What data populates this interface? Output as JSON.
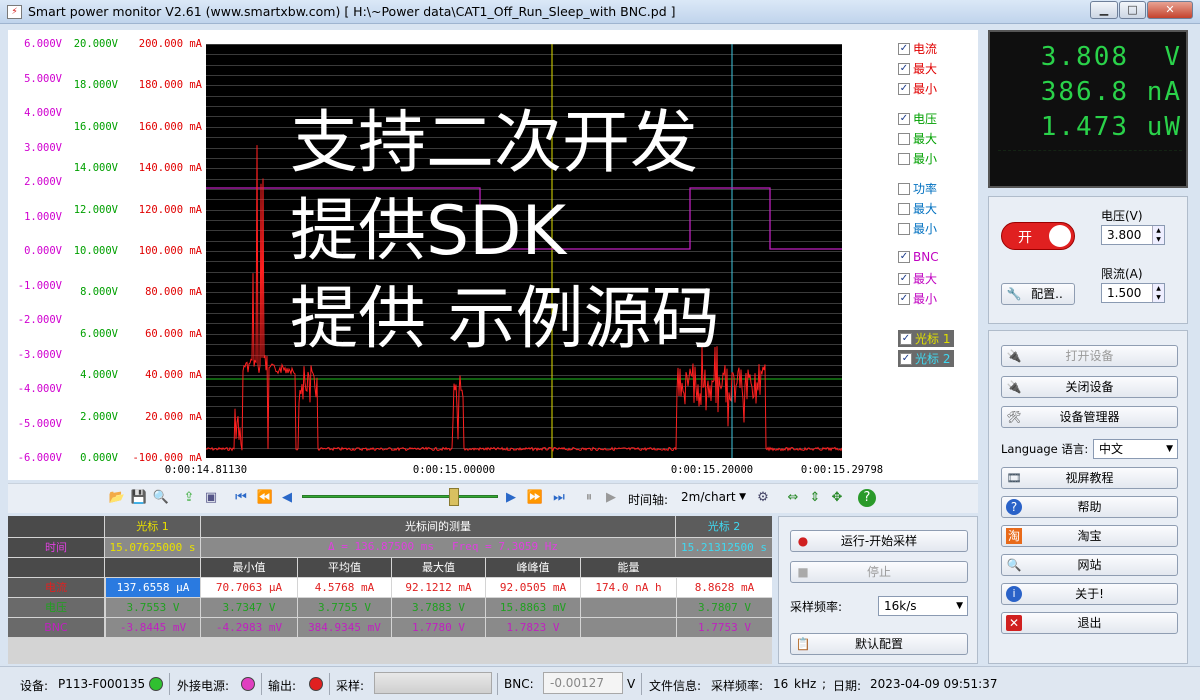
{
  "window": {
    "title": "Smart power monitor V2.61 (www.smartxbw.com) [ H:\\~Power data\\CAT1_Off_Run_Sleep_with BNC.pd ]",
    "min": "▁",
    "max": "□",
    "close": "✕"
  },
  "chart": {
    "overlay_lines": [
      "支持二次开发",
      "提供SDK",
      "提供 示例源码"
    ],
    "voltage_axis": [
      "6.000V",
      "5.000V",
      "4.000V",
      "3.000V",
      "2.000V",
      "1.000V",
      "0.000V",
      "-1.000V",
      "-2.000V",
      "-3.000V",
      "-4.000V",
      "-5.000V",
      "-6.000V"
    ],
    "bnc_axis": [
      "20.000V",
      "18.000V",
      "16.000V",
      "14.000V",
      "12.000V",
      "10.000V",
      "8.000V",
      "6.000V",
      "4.000V",
      "2.000V",
      "0.000V"
    ],
    "current_axis": [
      "200.000 mA",
      "180.000 mA",
      "160.000 mA",
      "140.000 mA",
      "120.000 mA",
      "100.000 mA",
      "80.000 mA",
      "60.000 mA",
      "40.000 mA",
      "20.000 mA",
      "-100.000 mA"
    ],
    "time_ticks": [
      "0:00:14.81130",
      "0:00:15.00000",
      "0:00:15.20000",
      "0:00:15.29798"
    ],
    "colors": {
      "voltage_axis": "#d000d0",
      "bnc_axis": "#00a000",
      "current_axis": "#e00000",
      "cursor1": "#e0e000",
      "cursor2": "#40c8e0"
    }
  },
  "chart_data": {
    "type": "line",
    "title": "",
    "xlabel": "",
    "ylabel": "",
    "x_range": [
      "0:00:14.81130",
      "0:00:15.29798"
    ],
    "series": [
      {
        "name": "电流",
        "color": "#ff2020"
      },
      {
        "name": "电压",
        "color": "#c020c0"
      },
      {
        "name": "BNC",
        "color": "#20c020"
      }
    ]
  },
  "legend": {
    "items": [
      {
        "label": "电流",
        "checked": true,
        "color": "#e00000"
      },
      {
        "label": "最大",
        "checked": true,
        "color": "#e00000"
      },
      {
        "label": "最小",
        "checked": true,
        "color": "#e00000"
      },
      {
        "label": "电压",
        "checked": true,
        "color": "#00a000"
      },
      {
        "label": "最大",
        "checked": false,
        "color": "#00a000"
      },
      {
        "label": "最小",
        "checked": false,
        "color": "#00a000"
      },
      {
        "label": "功率",
        "checked": false,
        "color": "#0070c0"
      },
      {
        "label": "最大",
        "checked": false,
        "color": "#0070c0"
      },
      {
        "label": "最小",
        "checked": false,
        "color": "#0070c0"
      },
      {
        "label": "BNC",
        "checked": true,
        "color": "#c000c0"
      },
      {
        "label": "最大",
        "checked": true,
        "color": "#c000c0"
      },
      {
        "label": "最小",
        "checked": true,
        "color": "#c000c0"
      },
      {
        "label": "光标 1",
        "checked": true,
        "color": "#e0e000",
        "bg": "#6a6a6a"
      },
      {
        "label": "光标 2",
        "checked": true,
        "color": "#40d8f0",
        "bg": "#6a6a6a"
      }
    ]
  },
  "toolbar": {
    "time_axis_label": "时间轴:",
    "time_axis_value": "2m/chart"
  },
  "measure": {
    "cursor1_header": "光标 1",
    "between_header": "光标间的测量",
    "cursor2_header": "光标 2",
    "time_label": "时间",
    "cursor1_time": "15.07625000 s",
    "delta_text": "Δ = 136.87500 ms",
    "freq_text": "Freq = 7.3059 Hz",
    "cursor2_time": "15.21312500 s",
    "columns": [
      "最小值",
      "平均值",
      "最大值",
      "峰峰值",
      "能量"
    ],
    "rows": [
      {
        "label": "电流",
        "c1": "137.6558 μA",
        "min": "70.7063 μA",
        "avg": "4.5768 mA",
        "max": "92.1212 mA",
        "pp": "92.0505 mA",
        "energy": "174.0 nA h",
        "c2": "8.8628 mA"
      },
      {
        "label": "电压",
        "c1": "3.7553 V",
        "min": "3.7347 V",
        "avg": "3.7755 V",
        "max": "3.7883 V",
        "pp": "15.8863 mV",
        "energy": "",
        "c2": "3.7807 V"
      },
      {
        "label": "BNC",
        "c1": "-3.8445 mV",
        "min": "-4.2983 mV",
        "avg": "384.9345 mV",
        "max": "1.7780 V",
        "pp": "1.7823 V",
        "energy": "",
        "c2": "1.7753 V"
      }
    ]
  },
  "run_panel": {
    "run_button": "运行-开始采样",
    "stop_button": "停止",
    "sample_rate_label": "采样频率:",
    "sample_rate_value": "16k/s",
    "default_config_button": "默认配置"
  },
  "lcd": {
    "voltage": "3.808",
    "voltage_unit": "V",
    "current": "386.8",
    "current_unit": "nA",
    "power": "1.473",
    "power_unit": "uW"
  },
  "power_ctrl": {
    "toggle_label": "开",
    "voltage_label": "电压(V)",
    "voltage_value": "3.800",
    "config_button": "配置..",
    "current_limit_label": "限流(A)",
    "current_limit_value": "1.500"
  },
  "side_buttons": {
    "open_device": "打开设备",
    "close_device": "关闭设备",
    "device_manager": "设备管理器",
    "language_label": "Language 语言:",
    "language_value": "中文",
    "video_tutorial": "视屏教程",
    "help": "帮助",
    "taobao": "淘宝",
    "website": "网站",
    "about": "关于!",
    "exit": "退出"
  },
  "status": {
    "device_label": "设备:",
    "device_value": "P113-F000135",
    "ext_power_label": "外接电源:",
    "output_label": "输出:",
    "sampling_label": "采样:",
    "bnc_label": "BNC:",
    "bnc_value": "-0.00127",
    "bnc_unit": "V",
    "file_info_label": "文件信息:",
    "file_rate_label": "采样频率:",
    "file_rate_value": "16",
    "file_rate_unit": "kHz",
    "date_sep": ";",
    "date_label": "日期:",
    "date_value": "2023-04-09 09:51:37"
  }
}
